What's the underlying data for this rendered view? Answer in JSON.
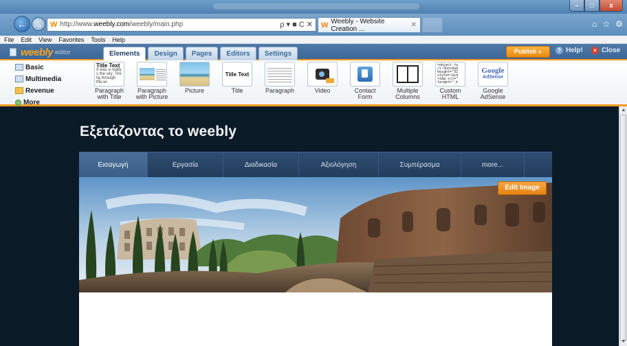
{
  "browser": {
    "address": {
      "prefix": "http://www.",
      "domain": "weebly.com",
      "path": "/weebly/main.php",
      "favicon": "W",
      "tools": "ρ ▾ ■ C ✕"
    },
    "tab": {
      "title": "Weebly - Website Creation ...",
      "close": "✕",
      "favicon": "W"
    },
    "window_controls": {
      "minimize": "–",
      "maximize": "□",
      "close": "x"
    },
    "right_icons": [
      "⌂",
      "☆",
      "⚙"
    ],
    "menu": [
      "File",
      "Edit",
      "View",
      "Favorites",
      "Tools",
      "Help"
    ]
  },
  "editor": {
    "logo": {
      "brand": "weebly",
      "suffix": "editor"
    },
    "tabs": [
      {
        "label": "Elements",
        "active": true
      },
      {
        "label": "Design",
        "active": false
      },
      {
        "label": "Pages",
        "active": false
      },
      {
        "label": "Editors",
        "active": false
      },
      {
        "label": "Settings",
        "active": false
      }
    ],
    "publish_label": "Publish »",
    "help_label": "Help!",
    "close_label": "Close",
    "accent": "#f59a1f"
  },
  "palette": {
    "categories": [
      "Basic",
      "Multimedia",
      "Revenue",
      "More"
    ],
    "items": [
      {
        "label1": "Paragraph",
        "label2": "with Title",
        "thumb_title": "Title Text",
        "thumb_body": "It was a really s the sky. The lig through the wi"
      },
      {
        "label1": "Paragraph",
        "label2": "with Picture"
      },
      {
        "label1": "Picture",
        "label2": ""
      },
      {
        "label1": "Title",
        "label2": "",
        "thumb_title": "Title Text"
      },
      {
        "label1": "Paragraph",
        "label2": ""
      },
      {
        "label1": "Video",
        "label2": ""
      },
      {
        "label1": "Contact",
        "label2": "Form"
      },
      {
        "label1": "Multiple",
        "label2": "Columns"
      },
      {
        "label1": "Custom",
        "label2": "HTML",
        "thumb_code": "<object ty\n/x-Shockwa\nheight=\"32\nstyle=\"wid\n<img src=\"\ntarget=\"_b"
      },
      {
        "label1": "Google",
        "label2": "AdSense",
        "thumb_brand": "Google",
        "thumb_sub": "AdSense"
      }
    ]
  },
  "site": {
    "title": "Εξετάζοντας το weebly",
    "nav": [
      {
        "label": "Εισαγωγή",
        "active": true
      },
      {
        "label": "Εργασία",
        "active": false
      },
      {
        "label": "Διαδικασία",
        "active": false
      },
      {
        "label": "Αξιολόγηση",
        "active": false
      },
      {
        "label": "Συμπέρασμα",
        "active": false
      },
      {
        "label": "more...",
        "active": false
      }
    ],
    "edit_image_label": "Edit Image",
    "background": "#0b1a27"
  }
}
